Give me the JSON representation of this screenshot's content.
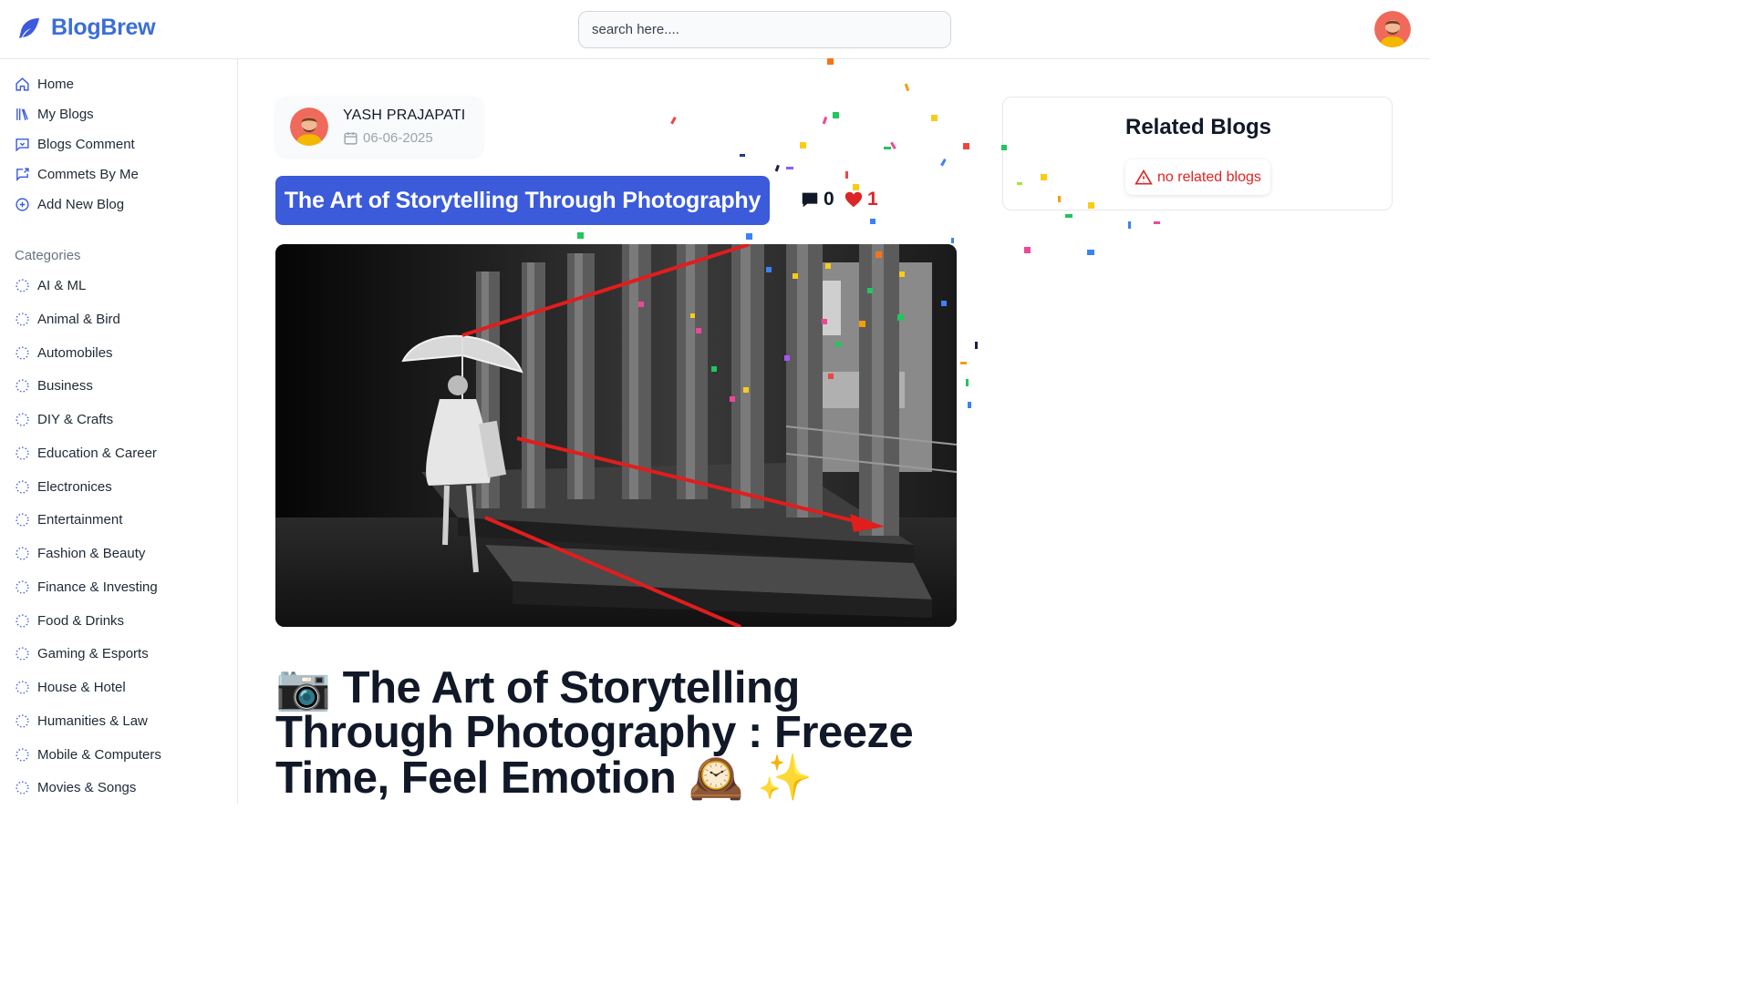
{
  "brand": {
    "name": "BlogBrew"
  },
  "search": {
    "placeholder": "search here...."
  },
  "sidebar": {
    "nav": [
      {
        "label": "Home",
        "icon": "home-icon"
      },
      {
        "label": "My Blogs",
        "icon": "library-icon"
      },
      {
        "label": "Blogs Comment",
        "icon": "message-square-icon"
      },
      {
        "label": "Commets By Me",
        "icon": "message-reply-icon"
      },
      {
        "label": "Add New Blog",
        "icon": "plus-circle-icon"
      }
    ],
    "categories_heading": "Categories",
    "categories": [
      "AI & ML",
      "Animal & Bird",
      "Automobiles",
      "Business",
      "DIY & Crafts",
      "Education & Career",
      "Electronices",
      "Entertainment",
      "Fashion & Beauty",
      "Finance & Investing",
      "Food & Drinks",
      "Gaming & Esports",
      "House & Hotel",
      "Humanities & Law",
      "Mobile & Computers",
      "Movies & Songs"
    ]
  },
  "post": {
    "author": "YASH PRAJAPATI",
    "date": "06-06-2025",
    "title": "The Art of Storytelling Through Photography",
    "comments": "0",
    "likes": "1",
    "heading_emoji_start": "📷",
    "heading_text": "The Art of Storytelling Through Photography : Freeze Time, Feel Emotion",
    "heading_emoji_end": "🕰️ ✨"
  },
  "related": {
    "title": "Related Blogs",
    "empty_message": "no related blogs"
  },
  "colors": {
    "brand": "#3b6fd6",
    "title_pill": "#3b5bdb",
    "like": "#dc2626",
    "error": "#dc2626"
  }
}
